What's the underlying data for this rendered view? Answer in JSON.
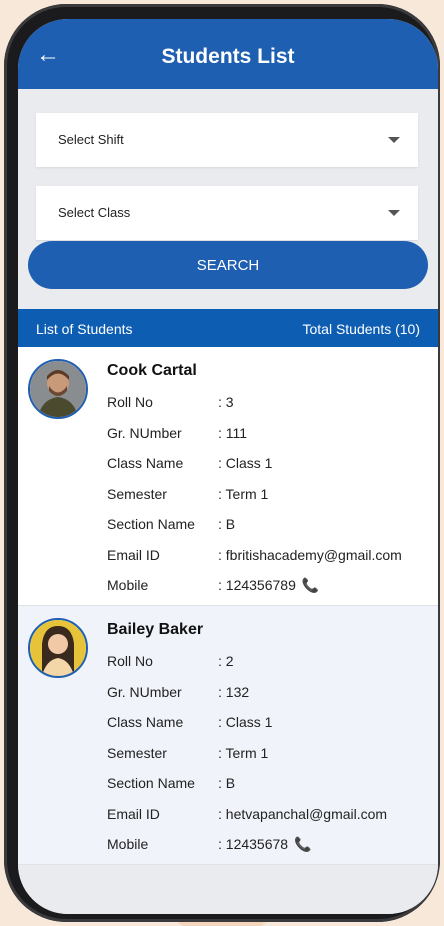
{
  "header": {
    "title": "Students List",
    "back_icon": "arrow-left-icon"
  },
  "filters": {
    "shift_label": "Select Shift",
    "class_label": "Select Class",
    "search_label": "SEARCH"
  },
  "list": {
    "left_label": "List of Students",
    "right_label": "Total Students (10)",
    "students": [
      {
        "name": "Cook Cartal",
        "rows": [
          {
            "label": "Roll No",
            "value": ": 3"
          },
          {
            "label": "Gr. NUmber",
            "value": ": 111"
          },
          {
            "label": "Class Name",
            "value": ": Class 1"
          },
          {
            "label": "Semester",
            "value": ": Term 1"
          },
          {
            "label": "Section Name",
            "value": ": B"
          },
          {
            "label": "Email ID",
            "value": ": fbritishacademy@gmail.com"
          },
          {
            "label": "Mobile",
            "value": ": 124356789"
          }
        ]
      },
      {
        "name": "Bailey Baker",
        "rows": [
          {
            "label": "Roll No",
            "value": ": 2"
          },
          {
            "label": "Gr. NUmber",
            "value": ": 132"
          },
          {
            "label": "Class Name",
            "value": ": Class 1"
          },
          {
            "label": "Semester",
            "value": ": Term 1"
          },
          {
            "label": "Section Name",
            "value": ": B"
          },
          {
            "label": "Email ID",
            "value": ": hetvapanchal@gmail.com"
          },
          {
            "label": "Mobile",
            "value": ": 12435678"
          }
        ]
      }
    ]
  },
  "colors": {
    "primary": "#1e5fb1",
    "header_bar": "#0d5db3",
    "phone_icon": "#14a6e6"
  }
}
